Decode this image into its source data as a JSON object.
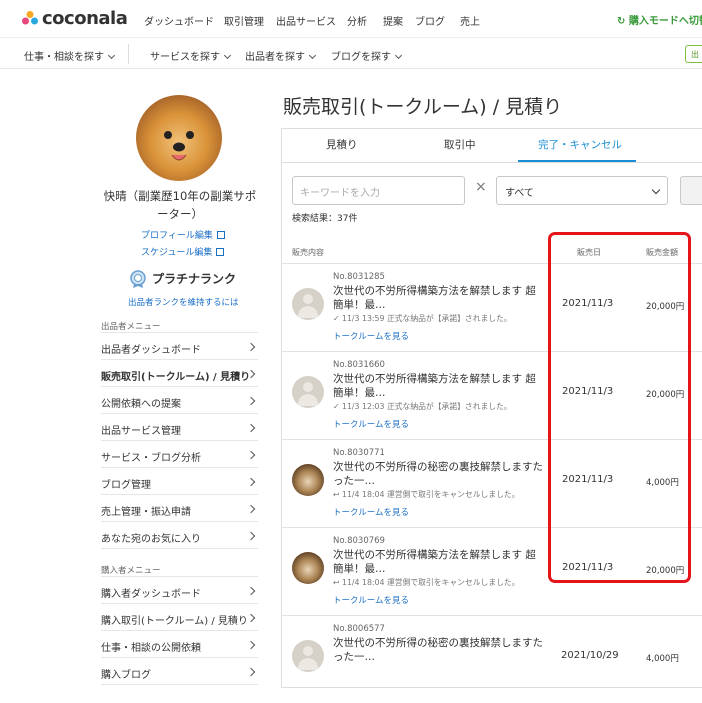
{
  "header": {
    "brand": "coconala",
    "nav": [
      "ダッシュボード",
      "取引管理",
      "出品サービス",
      "分析",
      "提案",
      "ブログ",
      "売上"
    ],
    "mode_link": "購入モードへ切替",
    "subnav": [
      "仕事・相談を探す",
      "サービスを探す",
      "出品者を探す",
      "ブログを探す"
    ],
    "out_button": "出"
  },
  "profile": {
    "name": "快晴（副業歴10年の副業サポーター）",
    "profile_edit": "プロフィール編集",
    "schedule_edit": "スケジュール編集",
    "rank": "プラチナランク",
    "rank_hint": "出品者ランクを維持するには"
  },
  "seller_menu": {
    "heading": "出品者メニュー",
    "items": [
      "出品者ダッシュボード",
      "販売取引(トークルーム) / 見積り",
      "公開依頼への提案",
      "出品サービス管理",
      "サービス・ブログ分析",
      "ブログ管理",
      "売上管理・振込申請",
      "あなた宛のお気に入り"
    ]
  },
  "buyer_menu": {
    "heading": "購入者メニュー",
    "items": [
      "購入者ダッシュボード",
      "購入取引(トークルーム) / 見積り",
      "仕事・相談の公開依頼",
      "購入ブログ"
    ]
  },
  "main": {
    "title": "販売取引(トークルーム) / 見積り",
    "tabs": [
      "見積り",
      "取引中",
      "完了・キャンセル"
    ],
    "active_tab": 2,
    "keyword_placeholder": "キーワードを入力",
    "clear": "×",
    "filter_value": "すべて",
    "result_count": "検索結果：37件",
    "col_content": "販売内容",
    "col_date": "販売日",
    "col_amount": "販売金額"
  },
  "rows": [
    {
      "no": "No.8031285",
      "title": "次世代の不労所得構築方法を解禁します 超簡単！最…",
      "status": "✓ 11/3 13:59 正式な納品が【承諾】されました。",
      "link": "トークルームを見る",
      "date": "2021/11/3",
      "amount": "20,000円",
      "avatar": "anon"
    },
    {
      "no": "No.8031660",
      "title": "次世代の不労所得構築方法を解禁します 超簡単！最…",
      "status": "✓ 11/3 12:03 正式な納品が【承諾】されました。",
      "link": "トークルームを見る",
      "date": "2021/11/3",
      "amount": "20,000円",
      "avatar": "anon"
    },
    {
      "no": "No.8030771",
      "title": "次世代の不労所得の秘密の裏技解禁しますたった一…",
      "status": "↩ 11/4 18:04 運営側で取引をキャンセルしました。",
      "link": "トークルームを見る",
      "date": "2021/11/3",
      "amount": "4,000円",
      "avatar": "cat"
    },
    {
      "no": "No.8030769",
      "title": "次世代の不労所得構築方法を解禁します 超簡単！最…",
      "status": "↩ 11/4 18:04 運営側で取引をキャンセルしました。",
      "link": "トークルームを見る",
      "date": "2021/11/3",
      "amount": "20,000円",
      "avatar": "cat"
    },
    {
      "no": "No.8006577",
      "title": "次世代の不労所得の秘密の裏技解禁しますたった一…",
      "status": "",
      "link": "",
      "date": "2021/10/29",
      "amount": "4,000円",
      "avatar": "anon"
    }
  ]
}
